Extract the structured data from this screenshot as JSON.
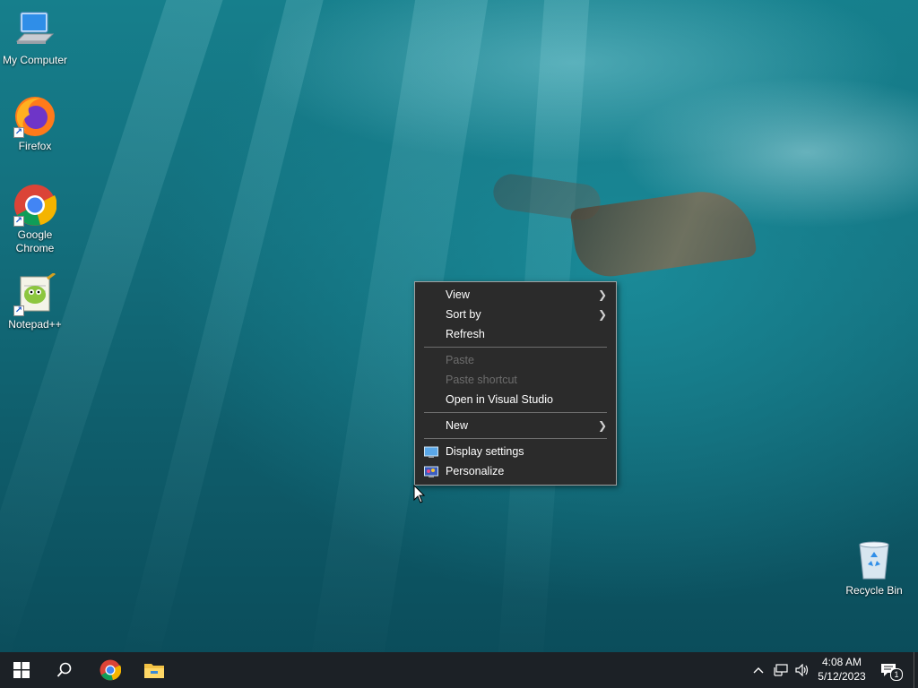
{
  "desktop": {
    "icons": [
      {
        "label": "My Computer",
        "icon": "computer-icon"
      },
      {
        "label": "Firefox",
        "icon": "firefox-icon"
      },
      {
        "label": "Google\nChrome",
        "icon": "chrome-icon"
      },
      {
        "label": "Notepad++",
        "icon": "notepadpp-icon"
      },
      {
        "label": "Recycle Bin",
        "icon": "recycle-bin-icon"
      }
    ]
  },
  "context_menu": {
    "items": [
      {
        "label": "View",
        "submenu": true,
        "enabled": true
      },
      {
        "label": "Sort by",
        "submenu": true,
        "enabled": true
      },
      {
        "label": "Refresh",
        "enabled": true
      },
      {
        "label": "Paste",
        "enabled": false
      },
      {
        "label": "Paste shortcut",
        "enabled": false
      },
      {
        "label": "Open in Visual Studio",
        "enabled": true
      },
      {
        "label": "New",
        "submenu": true,
        "enabled": true
      },
      {
        "label": "Display settings",
        "enabled": true,
        "icon": "display-settings-icon"
      },
      {
        "label": "Personalize",
        "enabled": true,
        "icon": "personalize-icon"
      }
    ],
    "arrow_glyph": "❯"
  },
  "taskbar": {
    "pinned": [
      "start-icon",
      "search-icon",
      "chrome-icon",
      "file-explorer-icon"
    ],
    "clock": {
      "time": "4:08 AM",
      "date": "5/12/2023"
    },
    "notification_count": "1"
  },
  "colors": {
    "taskbar": "#1c2126",
    "menu_bg": "#2b2b2b",
    "menu_disabled_text": "#6d6d6d"
  }
}
